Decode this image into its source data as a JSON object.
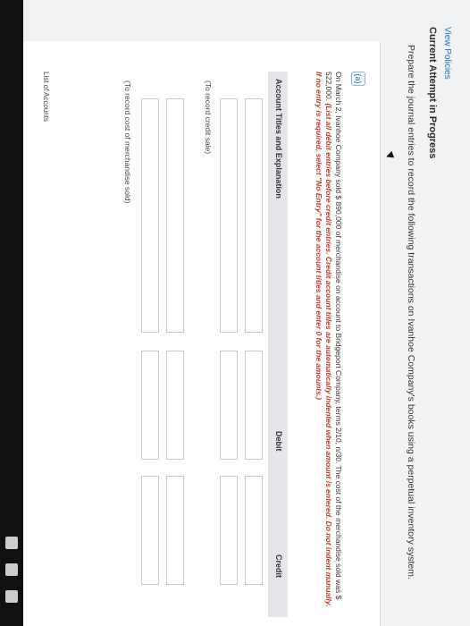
{
  "header": {
    "policies_link": "View Policies",
    "attempt_title": "Current Attempt in Progress",
    "prompt": "Prepare the journal entries to record the following transactions on Ivanhoe Company's books using a perpetual inventory system."
  },
  "question": {
    "part_label": "(a)",
    "text": "On March 2, Ivanhoe Company sold $ 890,000 of merchandise on account to Bridgeport Company, terms 2/10, n/30. The cost of the merchandise sold was $ 522,000.",
    "instructions": "(List all debit entries before credit entries. Credit account titles are automatically indented when amount is entered. Do not indent manually. If no entry is required, select \"No Entry\" for the account titles and enter 0 for the amounts.)"
  },
  "table": {
    "col_account": "Account Titles and Explanation",
    "col_debit": "Debit",
    "col_credit": "Credit",
    "note_sale": "(To record credit sale)",
    "note_cost": "(To record cost of merchandise sold)"
  },
  "footer": {
    "partial_list": "List of Accounts"
  }
}
